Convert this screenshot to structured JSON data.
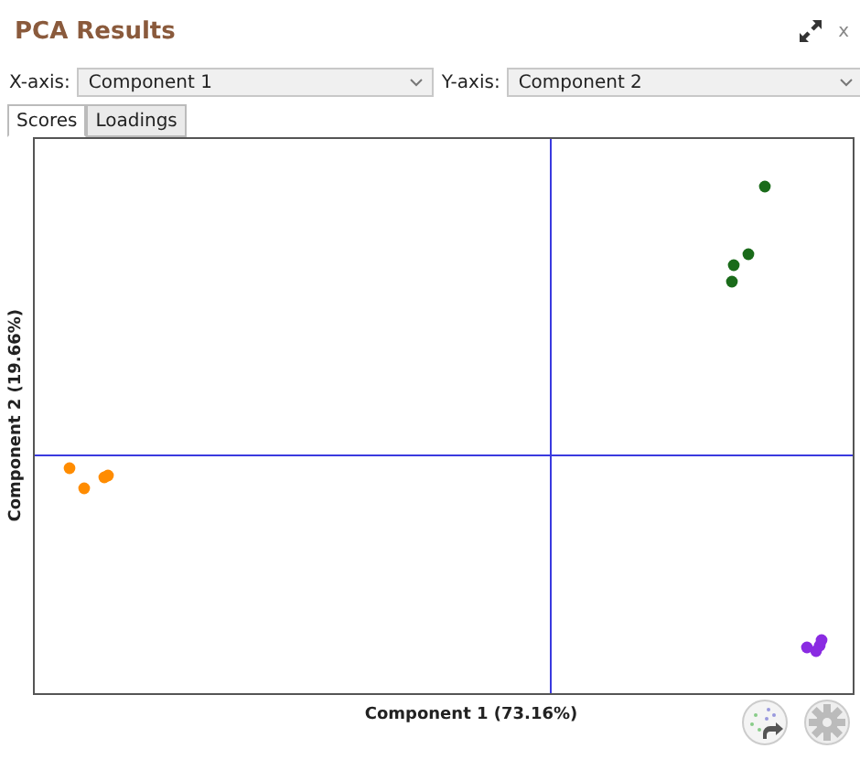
{
  "window": {
    "title": "PCA Results",
    "close": "x"
  },
  "axes": [
    {
      "label": "X-axis:",
      "value": "Component 1"
    },
    {
      "label": "Y-axis:",
      "value": "Component 2"
    }
  ],
  "tabs": [
    {
      "label": "Scores",
      "selected": true
    },
    {
      "label": "Loadings",
      "selected": false
    }
  ],
  "plot": {
    "xlabel": "Component 1 (73.16%)",
    "ylabel": "Component 2 (19.66%)"
  }
}
